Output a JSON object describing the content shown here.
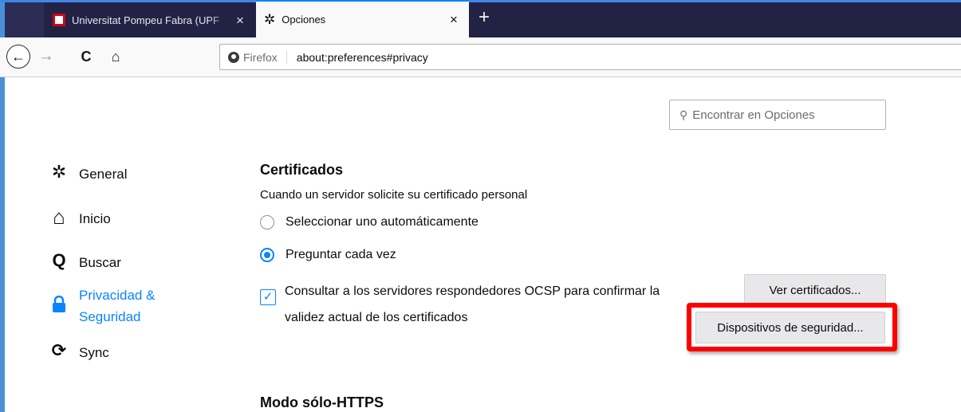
{
  "tabs": [
    {
      "title": "Universitat Pompeu Fabra (UPF",
      "close": "×",
      "favicon": "upf-logo-icon"
    },
    {
      "title": "Opciones",
      "close": "×",
      "favicon": "gear-icon"
    }
  ],
  "new_tab": "+",
  "nav": {
    "back": "←",
    "forward": "→",
    "reload": "C",
    "home": "⌂",
    "identity": "Firefox",
    "url": "about:preferences#privacy"
  },
  "search": {
    "icon": "⚲",
    "placeholder": "Encontrar en Opciones"
  },
  "sidebar": {
    "items": [
      {
        "label": "General",
        "icon": "⚙"
      },
      {
        "label": "Inicio",
        "icon": "⌂"
      },
      {
        "label": "Buscar",
        "icon": "Q"
      },
      {
        "label_line1": "Privacidad &",
        "label_line2": "Seguridad",
        "icon": "lock-icon"
      },
      {
        "label": "Sync",
        "icon": "⟳"
      }
    ]
  },
  "certificates": {
    "heading": "Certificados",
    "description": "Cuando un servidor solicite su certificado personal",
    "option_auto": "Seleccionar uno automáticamente",
    "option_ask": "Preguntar cada vez",
    "ocsp_line1": "Consultar a los servidores respondedores OCSP para confirmar la",
    "ocsp_line2": "validez actual de los certificados",
    "check_mark": "✓",
    "view_certs_button": "Ver certificados...",
    "security_devices_button": "Dispositivos de seguridad..."
  },
  "https_only": {
    "heading": "Modo sólo-HTTPS"
  },
  "colors": {
    "accent": "#0a84ff",
    "highlight": "#ff0000",
    "tabstrip": "#222244"
  }
}
